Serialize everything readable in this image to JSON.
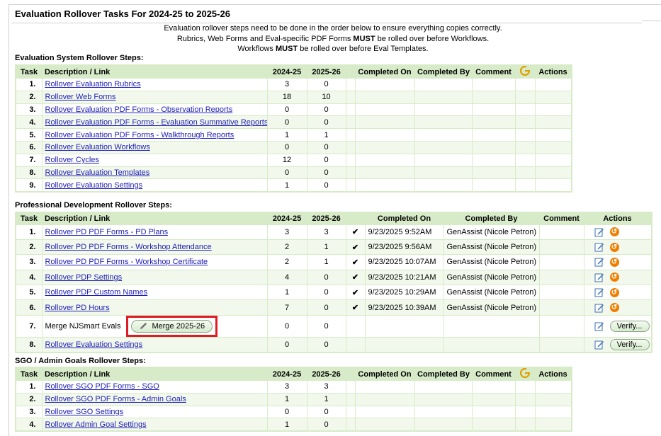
{
  "title": "Evaluation Rollover Tasks For 2024-25 to 2025-26",
  "notes": [
    {
      "parts": [
        {
          "t": "Evaluation rollover steps need to be done in the order below to ensure everything copies correctly.",
          "b": false
        }
      ]
    },
    {
      "parts": [
        {
          "t": "Rubrics, Web Forms and Eval-specific PDF Forms ",
          "b": false
        },
        {
          "t": "MUST",
          "b": true
        },
        {
          "t": " be rolled over before Workflows.",
          "b": false
        }
      ]
    },
    {
      "parts": [
        {
          "t": "Workflows ",
          "b": false
        },
        {
          "t": "MUST",
          "b": true
        },
        {
          "t": " be rolled over before Eval Templates.",
          "b": false
        }
      ]
    }
  ],
  "eval": {
    "title": "Evaluation System Rollover Steps:",
    "headers": [
      "Task",
      "Description / Link",
      "2024-25",
      "2025-26",
      "",
      "Completed On",
      "Completed By",
      "Comment",
      "G",
      "Actions"
    ],
    "rows": [
      {
        "task": "1.",
        "desc": "Rollover Evaluation Rubrics",
        "prev": "3",
        "next": "0"
      },
      {
        "task": "2.",
        "desc": "Rollover Web Forms",
        "prev": "18",
        "next": "10"
      },
      {
        "task": "3.",
        "desc": "Rollover Evaluation PDF Forms - Observation Reports",
        "prev": "0",
        "next": "0"
      },
      {
        "task": "4.",
        "desc": "Rollover Evaluation PDF Forms - Evaluation Summative Reports",
        "prev": "0",
        "next": "0"
      },
      {
        "task": "5.",
        "desc": "Rollover Evaluation PDF Forms - Walkthrough Reports",
        "prev": "1",
        "next": "1"
      },
      {
        "task": "6.",
        "desc": "Rollover Evaluation Workflows",
        "prev": "0",
        "next": "0"
      },
      {
        "task": "7.",
        "desc": "Rollover Cycles",
        "prev": "12",
        "next": "0"
      },
      {
        "task": "8.",
        "desc": "Rollover Evaluation Templates",
        "prev": "0",
        "next": "0"
      },
      {
        "task": "9.",
        "desc": "Rollover Evaluation Settings",
        "prev": "1",
        "next": "0"
      }
    ]
  },
  "pd": {
    "title": "Professional Development Rollover Steps:",
    "headers": [
      "Task",
      "Description / Link",
      "2024-25",
      "2025-26",
      "",
      "Completed On",
      "Completed By",
      "Comment",
      "Actions"
    ],
    "rows": [
      {
        "task": "1.",
        "desc": "Rollover PD PDF Forms - PD Plans",
        "prev": "3",
        "next": "3",
        "check": "✔",
        "on": "9/23/2025 9:52AM",
        "by": "GenAssist (Nicole Petron)",
        "action": "undo"
      },
      {
        "task": "2.",
        "desc": "Rollover PD PDF Forms - Workshop Attendance",
        "prev": "2",
        "next": "1",
        "check": "✔",
        "on": "9/23/2025 9:56AM",
        "by": "GenAssist (Nicole Petron)",
        "action": "undo"
      },
      {
        "task": "3.",
        "desc": "Rollover PD PDF Forms - Workshop Certificate",
        "prev": "2",
        "next": "1",
        "check": "✔",
        "on": "9/23/2025 10:07AM",
        "by": "GenAssist (Nicole Petron)",
        "action": "undo"
      },
      {
        "task": "4.",
        "desc": "Rollover PDP Settings",
        "prev": "4",
        "next": "0",
        "check": "✔",
        "on": "9/23/2025 10:21AM",
        "by": "GenAssist (Nicole Petron)",
        "action": "undo"
      },
      {
        "task": "5.",
        "desc": "Rollover PDP Custom Names",
        "prev": "1",
        "next": "0",
        "check": "✔",
        "on": "9/23/2025 10:29AM",
        "by": "GenAssist (Nicole Petron)",
        "action": "undo"
      },
      {
        "task": "6.",
        "desc": "Rollover PD Hours",
        "prev": "7",
        "next": "0",
        "check": "✔",
        "on": "9/23/2025 10:39AM",
        "by": "GenAssist (Nicole Petron)",
        "action": "undo"
      },
      {
        "task": "7.",
        "desc": "Merge NJSmart Evals",
        "plain": true,
        "merge_label": "Merge 2025-26",
        "prev": "0",
        "next": "0",
        "check": "",
        "on": "",
        "by": "",
        "action": "verify"
      },
      {
        "task": "8.",
        "desc": "Rollover Evaluation Settings",
        "prev": "0",
        "next": "0",
        "check": "",
        "on": "",
        "by": "",
        "action": "verify"
      }
    ],
    "verify_label": "Verify..."
  },
  "sgo": {
    "title": "SGO / Admin Goals Rollover Steps:",
    "headers": [
      "Task",
      "Description / Link",
      "2024-25",
      "2025-26",
      "",
      "Completed On",
      "Completed By",
      "Comment",
      "G",
      "Actions"
    ],
    "rows": [
      {
        "task": "1.",
        "desc": "Rollover SGO PDF Forms - SGO",
        "prev": "3",
        "next": "3"
      },
      {
        "task": "2.",
        "desc": "Rollover SGO PDF Forms - Admin Goals",
        "prev": "1",
        "next": "1"
      },
      {
        "task": "3.",
        "desc": "Rollover SGO Settings",
        "prev": "0",
        "next": "0"
      },
      {
        "task": "4.",
        "desc": "Rollover Admin Goal Settings",
        "prev": "1",
        "next": "0"
      }
    ]
  },
  "colors": {
    "header_bg": "#d7ebc8",
    "alt_row": "#f2f9ec",
    "link": "#2020b8",
    "undo": "#f07f00",
    "highlight": "#e11b22"
  }
}
